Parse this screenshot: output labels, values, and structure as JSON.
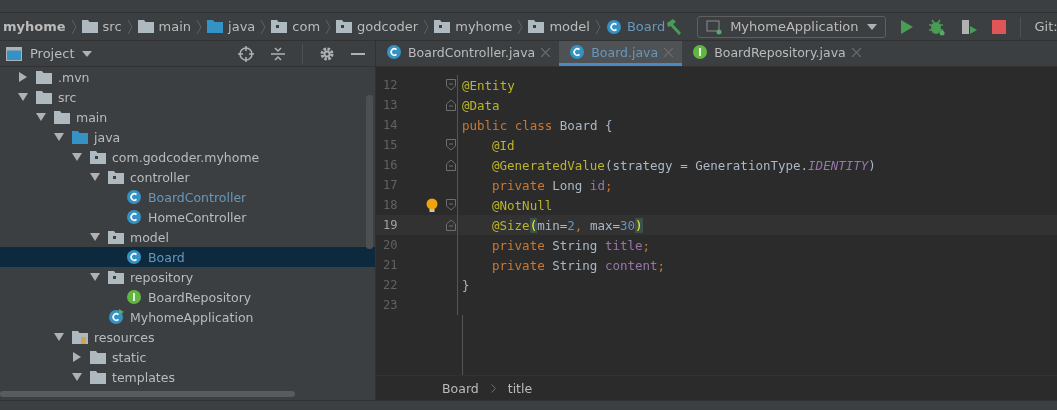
{
  "breadcrumbs": [
    {
      "label": "myhome",
      "kind": "project"
    },
    {
      "label": "src",
      "kind": "folder"
    },
    {
      "label": "main",
      "kind": "folder"
    },
    {
      "label": "java",
      "kind": "source"
    },
    {
      "label": "com",
      "kind": "package"
    },
    {
      "label": "godcoder",
      "kind": "package"
    },
    {
      "label": "myhome",
      "kind": "package"
    },
    {
      "label": "model",
      "kind": "package"
    },
    {
      "label": "Board",
      "kind": "class"
    }
  ],
  "run_config": {
    "label": "MyhomeApplication"
  },
  "vcs_label": "Git:",
  "project_panel": {
    "title": "Project",
    "tree": [
      {
        "label": ".mvn",
        "kind": "folder",
        "expanded": false,
        "selected": false
      },
      {
        "label": "src",
        "kind": "folder",
        "expanded": true,
        "selected": false,
        "children": [
          {
            "label": "main",
            "kind": "folder",
            "expanded": true,
            "selected": false,
            "children": [
              {
                "label": "java",
                "kind": "source",
                "expanded": true,
                "selected": false,
                "children": [
                  {
                    "label": "com.godcoder.myhome",
                    "kind": "package",
                    "expanded": true,
                    "selected": false,
                    "children": [
                      {
                        "label": "controller",
                        "kind": "package",
                        "expanded": true,
                        "selected": false,
                        "children": [
                          {
                            "label": "BoardController",
                            "kind": "class",
                            "selected": false,
                            "open": true
                          },
                          {
                            "label": "HomeController",
                            "kind": "class",
                            "selected": false,
                            "open": false
                          }
                        ]
                      },
                      {
                        "label": "model",
                        "kind": "package",
                        "expanded": true,
                        "selected": false,
                        "children": [
                          {
                            "label": "Board",
                            "kind": "class",
                            "selected": true,
                            "open": true
                          }
                        ]
                      },
                      {
                        "label": "repository",
                        "kind": "package",
                        "expanded": true,
                        "selected": false,
                        "children": [
                          {
                            "label": "BoardRepository",
                            "kind": "interface",
                            "selected": false,
                            "open": false
                          }
                        ]
                      },
                      {
                        "label": "MyhomeApplication",
                        "kind": "app",
                        "selected": false,
                        "open": false
                      }
                    ]
                  }
                ]
              },
              {
                "label": "resources",
                "kind": "resources",
                "expanded": true,
                "selected": false,
                "children": [
                  {
                    "label": "static",
                    "kind": "folder",
                    "expanded": false,
                    "selected": false
                  },
                  {
                    "label": "templates",
                    "kind": "folder",
                    "expanded": true,
                    "selected": false
                  }
                ]
              }
            ]
          }
        ]
      }
    ]
  },
  "tabs": [
    {
      "label": "BoardController.java",
      "kind": "class",
      "selected": false
    },
    {
      "label": "Board.java",
      "kind": "class",
      "selected": true
    },
    {
      "label": "BoardRepository.java",
      "kind": "interface",
      "selected": false
    }
  ],
  "code": [
    {
      "number": "12",
      "fold_start": true,
      "fold_end": false,
      "indented": false,
      "current": false,
      "bulb": false,
      "tokens": [
        {
          "kind": "annotation",
          "text": "@Entity"
        }
      ]
    },
    {
      "number": "13",
      "fold_start": false,
      "fold_end": true,
      "indented": false,
      "current": false,
      "bulb": false,
      "tokens": [
        {
          "kind": "annotation",
          "text": "@Data"
        }
      ]
    },
    {
      "number": "14",
      "fold_start": false,
      "fold_end": false,
      "indented": false,
      "current": false,
      "bulb": false,
      "tokens": [
        {
          "kind": "keyword",
          "text": "public class "
        },
        {
          "kind": "plain",
          "text": "Board {"
        }
      ]
    },
    {
      "number": "15",
      "fold_start": true,
      "fold_end": false,
      "indented": true,
      "current": false,
      "bulb": false,
      "tokens": [
        {
          "kind": "annotation",
          "text": "@Id"
        }
      ]
    },
    {
      "number": "16",
      "fold_start": false,
      "fold_end": true,
      "indented": true,
      "current": false,
      "bulb": false,
      "tokens": [
        {
          "kind": "annotation",
          "text": "@GeneratedValue"
        },
        {
          "kind": "plain",
          "text": "(strategy = GenerationType."
        },
        {
          "kind": "constant",
          "text": "IDENTITY"
        },
        {
          "kind": "plain",
          "text": ")"
        }
      ]
    },
    {
      "number": "17",
      "fold_start": false,
      "fold_end": false,
      "indented": true,
      "current": false,
      "bulb": false,
      "tokens": [
        {
          "kind": "keyword",
          "text": "private "
        },
        {
          "kind": "plain",
          "text": "Long "
        },
        {
          "kind": "field",
          "text": "id"
        },
        {
          "kind": "keyword",
          "text": ";"
        }
      ]
    },
    {
      "number": "18",
      "fold_start": true,
      "fold_end": false,
      "indented": true,
      "current": false,
      "bulb": true,
      "tokens": [
        {
          "kind": "annotation",
          "text": "@NotNull"
        }
      ]
    },
    {
      "number": "19",
      "fold_start": false,
      "fold_end": true,
      "indented": true,
      "current": true,
      "bulb": false,
      "tokens": [
        {
          "kind": "annotation",
          "text": "@Size"
        },
        {
          "kind": "brace",
          "text": "("
        },
        {
          "kind": "plain",
          "text": "min="
        },
        {
          "kind": "number",
          "text": "2"
        },
        {
          "kind": "keyword",
          "text": ", "
        },
        {
          "kind": "plain",
          "text": "max="
        },
        {
          "kind": "number",
          "text": "30"
        },
        {
          "kind": "brace",
          "text": ")"
        }
      ]
    },
    {
      "number": "20",
      "fold_start": false,
      "fold_end": false,
      "indented": true,
      "current": false,
      "bulb": false,
      "tokens": [
        {
          "kind": "keyword",
          "text": "private "
        },
        {
          "kind": "plain",
          "text": "String "
        },
        {
          "kind": "field",
          "text": "title"
        },
        {
          "kind": "keyword",
          "text": ";"
        }
      ]
    },
    {
      "number": "21",
      "fold_start": false,
      "fold_end": false,
      "indented": true,
      "current": false,
      "bulb": false,
      "tokens": [
        {
          "kind": "keyword",
          "text": "private "
        },
        {
          "kind": "plain",
          "text": "String "
        },
        {
          "kind": "field",
          "text": "content"
        },
        {
          "kind": "keyword",
          "text": ";"
        }
      ]
    },
    {
      "number": "22",
      "fold_start": false,
      "fold_end": false,
      "indented": false,
      "current": false,
      "bulb": false,
      "tokens": [
        {
          "kind": "plain",
          "text": "}"
        }
      ]
    },
    {
      "number": "23",
      "fold_start": false,
      "fold_end": false,
      "current": false,
      "bulb": false
    }
  ],
  "editor_breadcrumbs": [
    "Board",
    "title"
  ]
}
